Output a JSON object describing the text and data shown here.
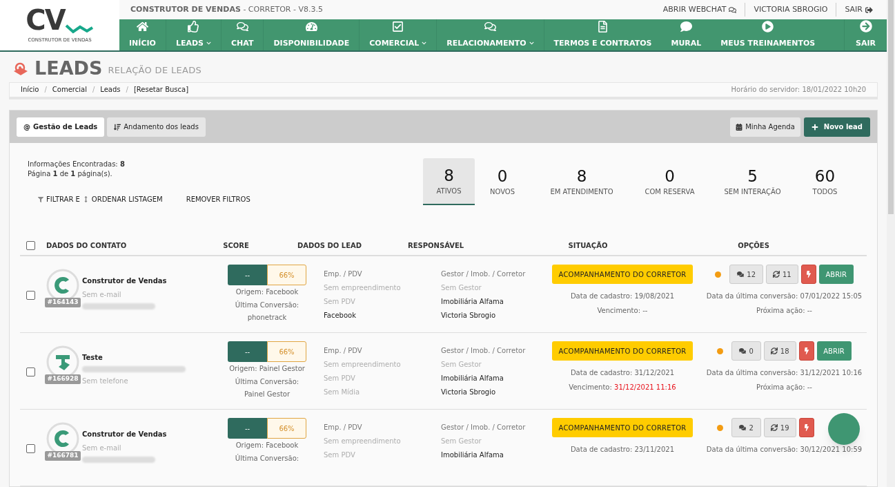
{
  "logo": {
    "mark": "CV",
    "caption": "CONSTRUTOR DE VENDAS"
  },
  "app_title": "**CONSTRUTOR DE VENDAS** - CORRETOR - V8.3.5",
  "top_links": [
    "ABRIR WEBCHAT",
    "VICTORIA SBROGIO",
    "SAIR"
  ],
  "nav": [
    {
      "label": "INÍCIO",
      "dropdown": false
    },
    {
      "label": "LEADS",
      "dropdown": true
    },
    {
      "label": "CHAT",
      "dropdown": false
    },
    {
      "label": "DISPONIBILIDADE",
      "dropdown": false
    },
    {
      "label": "COMERCIAL",
      "dropdown": true
    },
    {
      "label": "RELACIONAMENTO",
      "dropdown": true
    },
    {
      "label": "TERMOS E CONTRATOS",
      "dropdown": false
    },
    {
      "label": "MURAL",
      "dropdown": false
    },
    {
      "label": "MEUS TREINAMENTOS",
      "dropdown": false
    }
  ],
  "nav_exit": "SAIR",
  "page": {
    "title": "LEADS",
    "subtitle": "RELAÇÃO DE LEADS"
  },
  "breadcrumb": [
    "Início",
    "Comercial",
    "Leads",
    "[Resetar Busca]"
  ],
  "breadcrumb_separator": "/",
  "server_time": "Horário do servidor: 18/01/2022 10h20",
  "tabs": [
    {
      "label": "Gestão de Leads",
      "selected": true
    },
    {
      "label": "Andamento dos leads",
      "selected": false
    }
  ],
  "tab_prefix": "@",
  "actions": [
    "Minha Agenda",
    "Novo lead"
  ],
  "info": [
    "Informações Encontradas: **8**",
    "Página **1** de **1** página(s)."
  ],
  "filters": [
    "FILTRAR E",
    "ORDENAR LISTAGEM",
    "REMOVER FILTROS"
  ],
  "stats": [
    {
      "value": "8",
      "label": "ATIVOS",
      "selected": true
    },
    {
      "value": "0",
      "label": "NOVOS",
      "selected": false
    },
    {
      "value": "8",
      "label": "EM ATENDIMENTO",
      "selected": false
    },
    {
      "value": "0",
      "label": "COM RESERVA",
      "selected": false
    },
    {
      "value": "5",
      "label": "SEM INTERAÇÃO",
      "selected": false
    },
    {
      "value": "60",
      "label": "TODOS",
      "selected": false
    }
  ],
  "table": {
    "select_all_checked": false,
    "columns": [
      "DADOS DO CONTATO",
      "SCORE",
      "DADOS DO LEAD",
      "RESPONSÁVEL",
      "SITUAÇÃO",
      "OPÇÕES"
    ],
    "rows": [
      {
        "checked": false,
        "name": "Construtor de Vendas",
        "contact": [
          {
            "kind": "text",
            "text": "Sem e-mail"
          },
          {
            "kind": "blurred"
          }
        ],
        "id": "#164143",
        "score": "--",
        "percent": "66%",
        "origin": [
          "Origem: Facebook",
          "Última Conversão: phonetrack"
        ],
        "lead": [
          {
            "text": "Emp. / PDV",
            "kind": "label"
          },
          {
            "text": "Sem empreendimento",
            "kind": "empty"
          },
          {
            "text": "Sem PDV",
            "kind": "empty"
          },
          {
            "text": "Facebook",
            "kind": "value"
          }
        ],
        "responsible": [
          {
            "text": "Gestor / Imob. / Corretor",
            "kind": "label"
          },
          {
            "text": "Sem Gestor",
            "kind": "empty"
          },
          {
            "text": "Imobiliária Alfama",
            "kind": "value"
          },
          {
            "text": "Victoria Sbrogio",
            "kind": "value"
          }
        ],
        "status": "ACOMPANHAMENTO DO CORRETOR",
        "registered": "Data de cadastro: 19/08/2021",
        "due_label": "Vencimento:",
        "due": "--",
        "overdue": false,
        "color": "#f39c12",
        "comments": "12",
        "syncs": "11",
        "open": "ABRIR",
        "last_conversion": "Data da última conversão: 07/01/2022 15:05",
        "next_action": "Próxima ação: --"
      },
      {
        "checked": false,
        "name": "Teste",
        "contact": [
          {
            "kind": "blurred"
          },
          {
            "kind": "text",
            "text": "Sem telefone"
          }
        ],
        "id": "#166928",
        "score": "--",
        "percent": "66%",
        "origin": [
          "Origem: Painel Gestor",
          "Última Conversão: Painel Gestor"
        ],
        "lead": [
          {
            "text": "Emp. / PDV",
            "kind": "label"
          },
          {
            "text": "Sem empreendimento",
            "kind": "empty"
          },
          {
            "text": "Sem PDV",
            "kind": "empty"
          },
          {
            "text": "Sem Mídia",
            "kind": "empty"
          }
        ],
        "responsible": [
          {
            "text": "Gestor / Imob. / Corretor",
            "kind": "label"
          },
          {
            "text": "Sem Gestor",
            "kind": "empty"
          },
          {
            "text": "Imobiliária Alfama",
            "kind": "value"
          },
          {
            "text": "Victoria Sbrogio",
            "kind": "value"
          }
        ],
        "status": "ACOMPANHAMENTO DO CORRETOR",
        "registered": "Data de cadastro: 31/12/2021",
        "due_label": "Vencimento:",
        "due": "31/12/2021 11:16",
        "overdue": true,
        "color": "#f39c12",
        "comments": "0",
        "syncs": "18",
        "open": "ABRIR",
        "last_conversion": "Data da última conversão: 31/12/2021 10:16",
        "next_action": "Próxima ação: --"
      },
      {
        "checked": false,
        "name": "Construtor de Vendas",
        "contact": [
          {
            "kind": "text",
            "text": "Sem e-mail"
          },
          {
            "kind": "blurred"
          }
        ],
        "id": "#166781",
        "score": "--",
        "percent": "66%",
        "origin": [
          "Origem: Facebook",
          "Última Conversão:"
        ],
        "lead": [
          {
            "text": "Emp. / PDV",
            "kind": "label"
          },
          {
            "text": "Sem empreendimento",
            "kind": "empty"
          },
          {
            "text": "Sem PDV",
            "kind": "empty"
          }
        ],
        "responsible": [
          {
            "text": "Gestor / Imob. / Corretor",
            "kind": "label"
          },
          {
            "text": "Sem Gestor",
            "kind": "empty"
          },
          {
            "text": "Imobiliária Alfama",
            "kind": "value"
          }
        ],
        "status": "ACOMPANHAMENTO DO CORRETOR",
        "registered": "Data de cadastro: 23/11/2021",
        "color": "#f39c12",
        "comments": "2",
        "syncs": "19",
        "last_conversion": "Data da última conversão: 30/12/2021 10:59"
      }
    ]
  }
}
